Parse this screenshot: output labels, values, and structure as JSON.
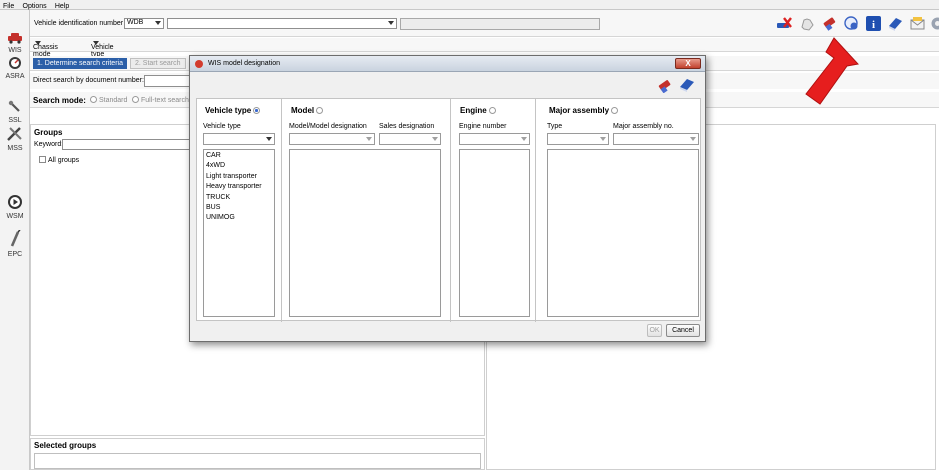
{
  "menu": [
    "File",
    "Options",
    "Help"
  ],
  "nav": [
    {
      "label": "WIS",
      "icon": "car-icon"
    },
    {
      "label": "ASRA",
      "icon": "gauge-icon"
    },
    {
      "label": "SSL",
      "icon": "wrench-icon"
    },
    {
      "label": "MSS",
      "icon": "tools-icon"
    },
    {
      "label": "WSM",
      "icon": "play-icon"
    },
    {
      "label": "EPC",
      "icon": "spark-plug-icon"
    }
  ],
  "vin": {
    "label": "Vehicle identification number",
    "prefix": "WDB",
    "value": ""
  },
  "chassis": {
    "mode_label": "Chassis mode",
    "type_label": "Vehicle type"
  },
  "steps": {
    "step1": "1. Determine search criteria",
    "step2": "2. Start search"
  },
  "direct_search": {
    "label": "Direct search by document number:"
  },
  "search_mode": {
    "label": "Search mode:",
    "options": [
      "Standard",
      "Full-text search"
    ]
  },
  "groups": {
    "title": "Groups",
    "keyword_label": "Keyword:",
    "all_groups": "All groups"
  },
  "selected_groups": {
    "title": "Selected groups"
  },
  "dialog": {
    "title": "WIS model designation",
    "close": "X",
    "vehicle_type": {
      "title": "Vehicle type",
      "select_label": "Vehicle type",
      "items": [
        "CAR",
        "4xWD",
        "Light transporter",
        "Heavy transporter",
        "TRUCK",
        "BUS",
        "UNIMOG"
      ]
    },
    "model": {
      "title": "Model",
      "model_label": "Model/Model designation",
      "sales_label": "Sales designation"
    },
    "engine": {
      "title": "Engine",
      "engine_label": "Engine number"
    },
    "major_assembly": {
      "title": "Major assembly",
      "type_label": "Type",
      "no_label": "Major assembly no."
    },
    "ok": "OK",
    "cancel": "Cancel"
  },
  "colors": {
    "accent": "#2c5fa8",
    "arrow": "#e61e1e"
  }
}
